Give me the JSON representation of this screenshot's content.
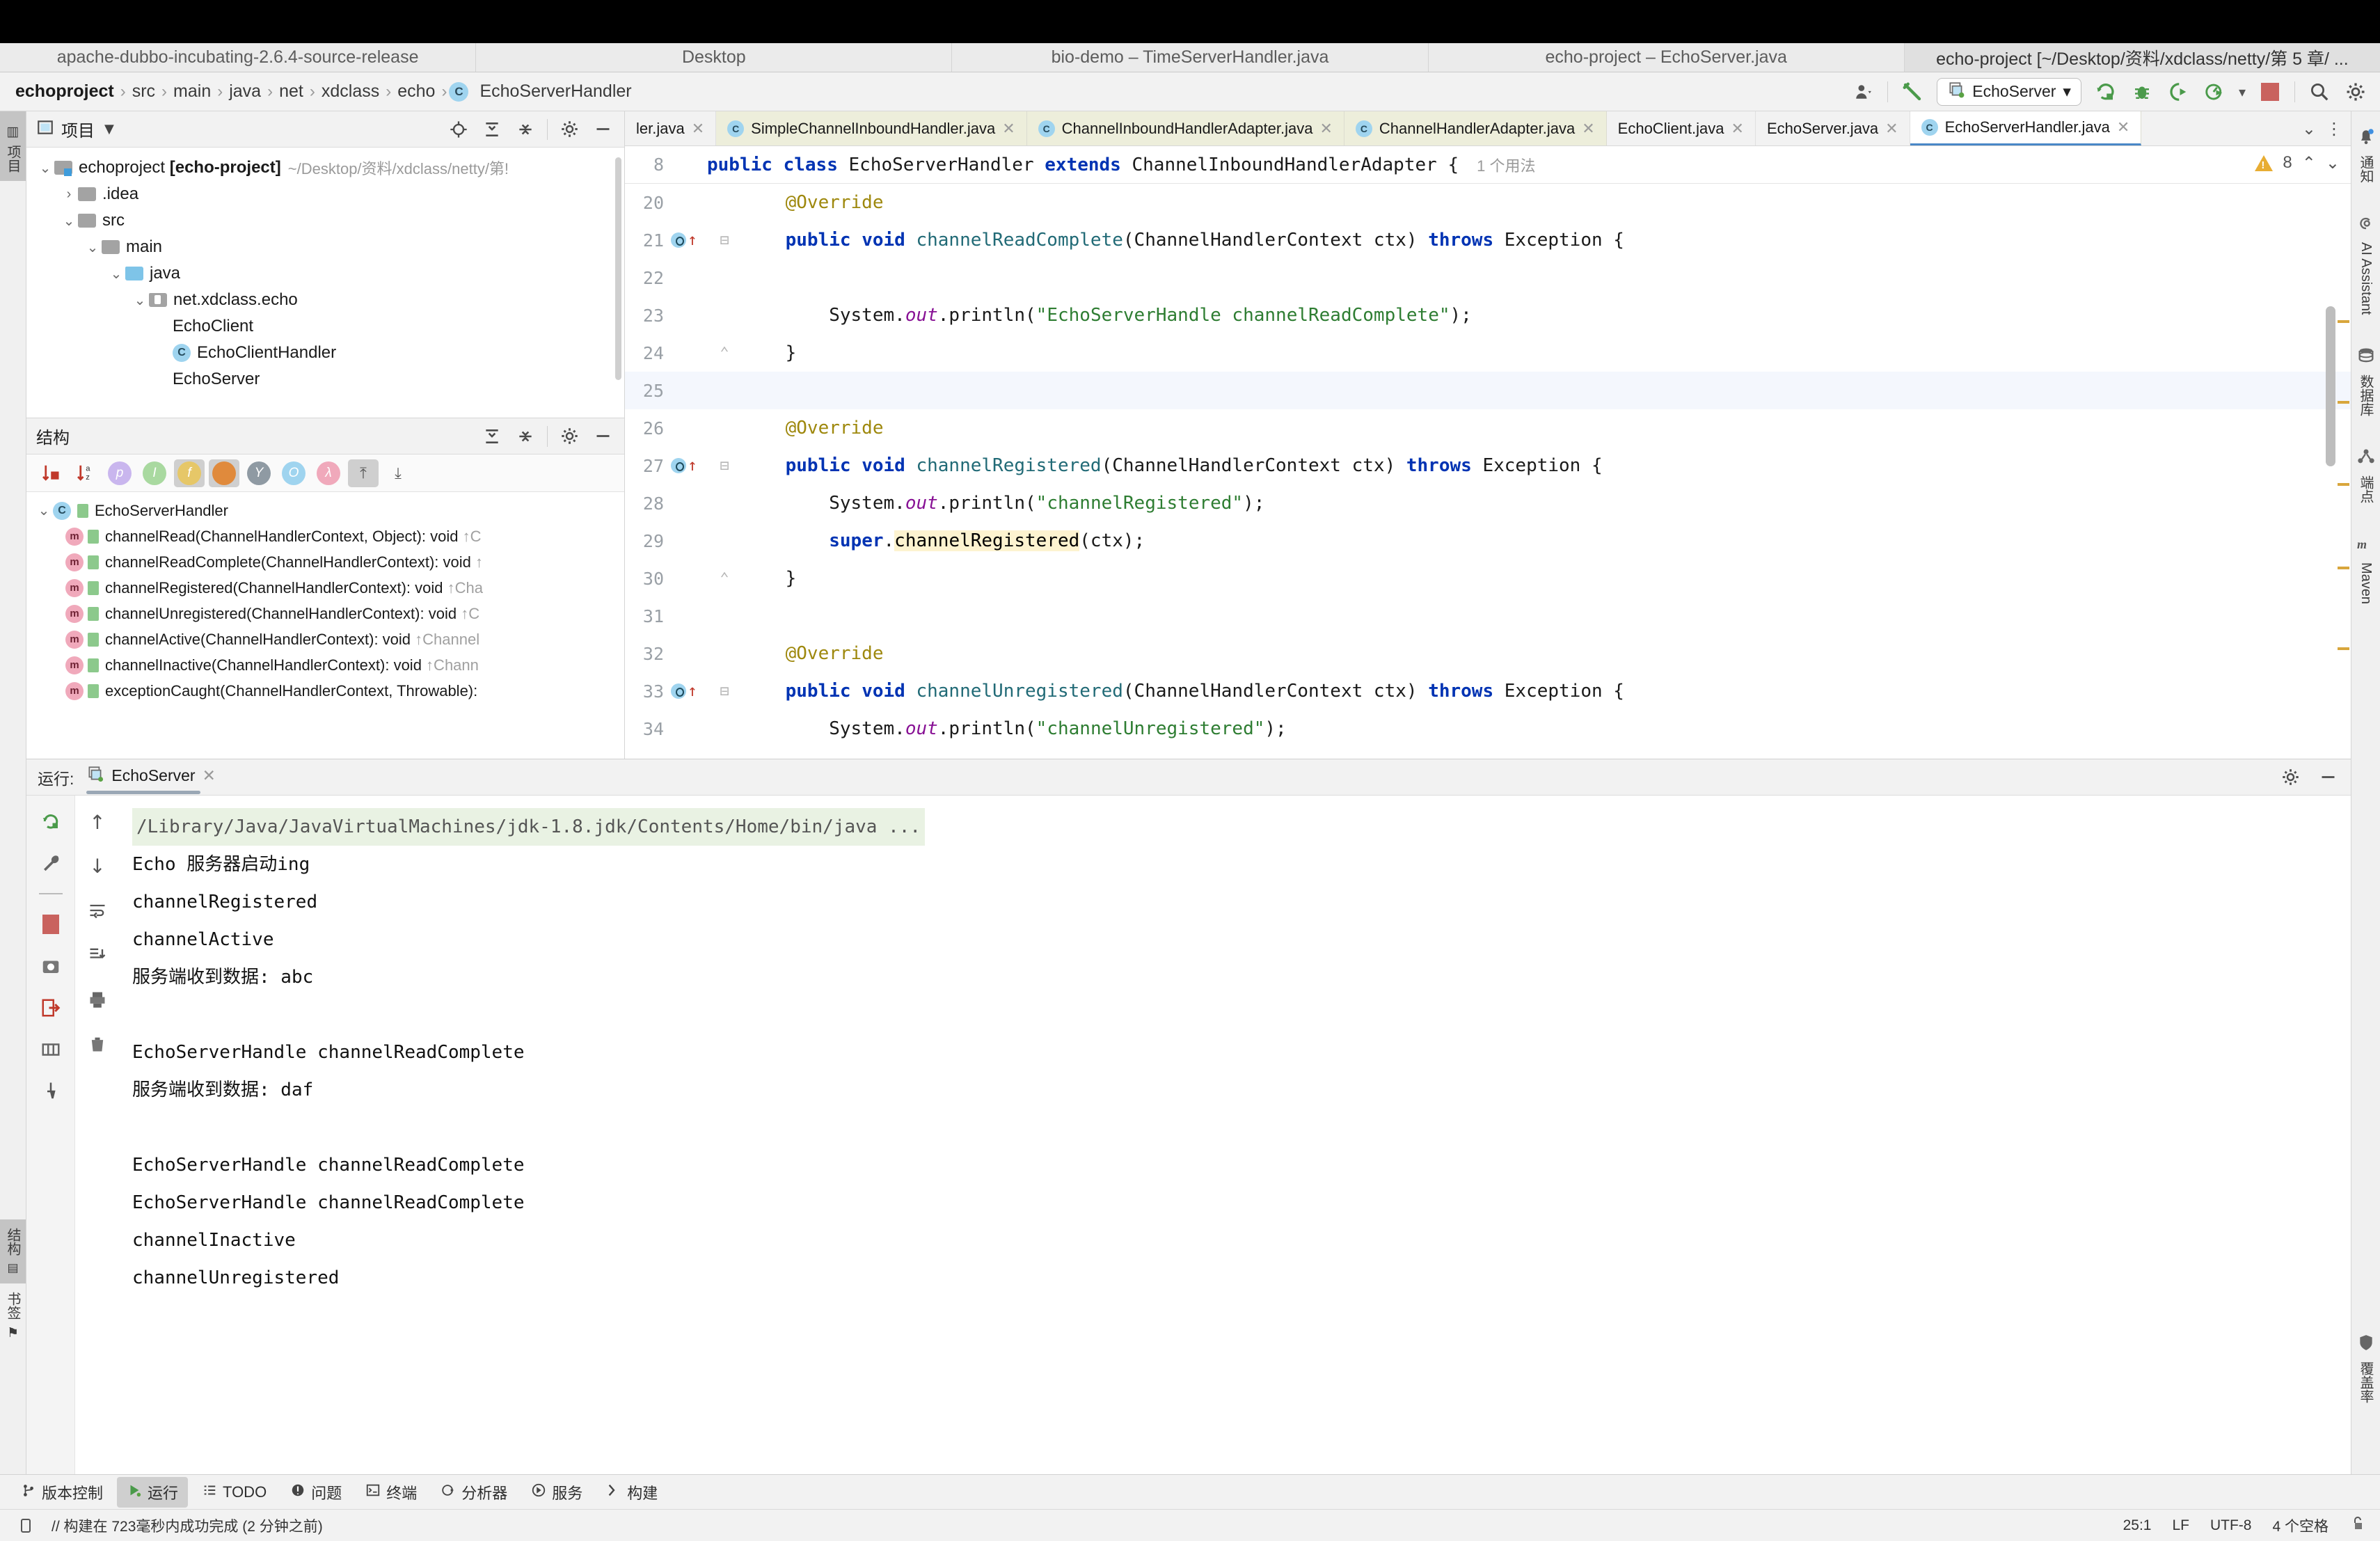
{
  "window_tabs": [
    {
      "label": "apache-dubbo-incubating-2.6.4-source-release",
      "active": false
    },
    {
      "label": "Desktop",
      "active": false
    },
    {
      "label": "bio-demo – TimeServerHandler.java",
      "active": false
    },
    {
      "label": "echo-project – EchoServer.java",
      "active": false
    },
    {
      "label": "echo-project [~/Desktop/资料/xdclass/netty/第 5 章/ ...",
      "active": true
    }
  ],
  "breadcrumb": {
    "items": [
      "echoproject",
      "src",
      "main",
      "java",
      "net",
      "xdclass",
      "echo"
    ],
    "file": "EchoServerHandler",
    "file_icon": "class-icon"
  },
  "toolbar": {
    "account_icon": "user-account-icon",
    "build_icon": "hammer-icon",
    "run_config": "EchoServer",
    "run_icon": "run-icon",
    "debug_icon": "debug-icon",
    "run_coverage_icon": "coverage-icon",
    "profiler_icon": "profiler-icon",
    "stop_icon": "stop-icon",
    "search_icon": "search-icon",
    "settings_icon": "gear-icon"
  },
  "left_rail": [
    {
      "label": "项目",
      "icon": "project-icon",
      "selected": true
    },
    {
      "label": "结构",
      "icon": "structure-icon",
      "selected": true
    },
    {
      "label": "书签",
      "icon": "bookmarks-icon",
      "selected": false
    }
  ],
  "right_rail": [
    {
      "label": "通知",
      "icon": "bell-icon"
    },
    {
      "label": "AI Assistant",
      "icon": "ai-assistant-icon"
    },
    {
      "label": "数据库",
      "icon": "database-icon"
    },
    {
      "label": "端点",
      "icon": "endpoints-icon"
    },
    {
      "label": "Maven",
      "icon": "maven-icon"
    },
    {
      "label": "覆盖率",
      "icon": "coverage-shield-icon"
    }
  ],
  "project_panel": {
    "title": "项目",
    "dropdown_icon": "chevron-down-icon",
    "actions": [
      "locate-icon",
      "expand-all-icon",
      "collapse-all-icon",
      "gear-icon",
      "minimize-icon"
    ],
    "tree": [
      {
        "indent": 0,
        "arrow": "v",
        "icon": "module-folder",
        "label": "echoproject",
        "bold_label": "[echo-project]",
        "path": "~/Desktop/资料/xdclass/netty/第!"
      },
      {
        "indent": 1,
        "arrow": ">",
        "icon": "folder",
        "label": ".idea",
        "bold_label": "",
        "path": ""
      },
      {
        "indent": 1,
        "arrow": "v",
        "icon": "folder",
        "label": "src",
        "bold_label": "",
        "path": ""
      },
      {
        "indent": 2,
        "arrow": "v",
        "icon": "folder",
        "label": "main",
        "bold_label": "",
        "path": ""
      },
      {
        "indent": 3,
        "arrow": "v",
        "icon": "folder-blue",
        "label": "java",
        "bold_label": "",
        "path": ""
      },
      {
        "indent": 4,
        "arrow": "v",
        "icon": "package",
        "label": "net.xdclass.echo",
        "bold_label": "",
        "path": ""
      },
      {
        "indent": 5,
        "arrow": "",
        "icon": "class-run",
        "label": "EchoClient",
        "bold_label": "",
        "path": ""
      },
      {
        "indent": 5,
        "arrow": "",
        "icon": "class",
        "label": "EchoClientHandler",
        "bold_label": "",
        "path": ""
      },
      {
        "indent": 5,
        "arrow": "",
        "icon": "class-run",
        "label": "EchoServer",
        "bold_label": "",
        "path": ""
      }
    ]
  },
  "structure_panel": {
    "title": "结构",
    "actions": [
      "expand-all-icon",
      "collapse-all-icon",
      "gear-icon",
      "minimize-icon"
    ],
    "filters": [
      {
        "name": "sort-by-visibility-icon",
        "glyph": "↓",
        "kind": "sort"
      },
      {
        "name": "sort-alphabetically-icon",
        "glyph": "↓",
        "kind": "sort"
      },
      {
        "name": "show-properties-icon",
        "glyph": "p",
        "color": "#c9b6ee"
      },
      {
        "name": "show-inherited-icon",
        "glyph": "I",
        "color": "#a9d9a0"
      },
      {
        "name": "show-fields-icon",
        "glyph": "f",
        "color": "#e6c768",
        "active": true
      },
      {
        "name": "show-non-public-icon",
        "glyph": "",
        "color": "#e08a3c",
        "active": true
      },
      {
        "name": "group-by-icon",
        "glyph": "Y",
        "color": "#8f9aa3"
      },
      {
        "name": "show-anonymous-icon",
        "glyph": "O",
        "color": "#9fd4ef"
      },
      {
        "name": "show-lambdas-icon",
        "glyph": "λ",
        "color": "#f0a9bb"
      },
      {
        "name": "expand-all-icon",
        "glyph": "⤒",
        "active": true
      },
      {
        "name": "collapse-all-icon",
        "glyph": "⤓"
      }
    ],
    "tree": [
      {
        "kind": "class",
        "label": "EchoServerHandler",
        "suffix": ""
      },
      {
        "kind": "method",
        "label": "channelRead(ChannelHandlerContext, Object): void",
        "suffix": "↑C"
      },
      {
        "kind": "method",
        "label": "channelReadComplete(ChannelHandlerContext): void",
        "suffix": "↑"
      },
      {
        "kind": "method",
        "label": "channelRegistered(ChannelHandlerContext): void",
        "suffix": "↑Cha"
      },
      {
        "kind": "method",
        "label": "channelUnregistered(ChannelHandlerContext): void",
        "suffix": "↑C"
      },
      {
        "kind": "method",
        "label": "channelActive(ChannelHandlerContext): void",
        "suffix": "↑Channel"
      },
      {
        "kind": "method",
        "label": "channelInactive(ChannelHandlerContext): void",
        "suffix": "↑Chann"
      },
      {
        "kind": "method",
        "label": "exceptionCaught(ChannelHandlerContext, Throwable):",
        "suffix": ""
      }
    ]
  },
  "editor_tabs": [
    {
      "label": "ler.java",
      "icon": "",
      "state": "clipped"
    },
    {
      "label": "SimpleChannelInboundHandler.java",
      "icon": "class-icon",
      "state": "library"
    },
    {
      "label": "ChannelInboundHandlerAdapter.java",
      "icon": "class-icon",
      "state": "library"
    },
    {
      "label": "ChannelHandlerAdapter.java",
      "icon": "class-icon",
      "state": "library"
    },
    {
      "label": "EchoClient.java",
      "icon": "class-run-icon",
      "state": "plain"
    },
    {
      "label": "EchoServer.java",
      "icon": "class-run-icon",
      "state": "plain"
    },
    {
      "label": "EchoServerHandler.java",
      "icon": "class-icon",
      "state": "active"
    }
  ],
  "editor": {
    "sticky_line_number": "8",
    "sticky_usage_hint": "1 个用法",
    "warning_count": "8",
    "warning_icon": "warning-triangle-icon",
    "prev_icon": "chevron-up-icon",
    "next_icon": "chevron-down-icon",
    "sticky_code": [
      {
        "t": "public ",
        "c": "kw"
      },
      {
        "t": "class ",
        "c": "kw"
      },
      {
        "t": "EchoServerHandler ",
        "c": "pl"
      },
      {
        "t": "extends ",
        "c": "kw"
      },
      {
        "t": "ChannelInboundHandlerAdapter {",
        "c": "pl"
      }
    ],
    "lines": [
      {
        "n": "20",
        "gutter": "",
        "fold": "",
        "cur": false,
        "parts": [
          {
            "t": "    @Override",
            "c": "ann"
          }
        ]
      },
      {
        "n": "21",
        "gutter": "override",
        "fold": "-",
        "cur": false,
        "parts": [
          {
            "t": "    ",
            "c": "pl"
          },
          {
            "t": "public void ",
            "c": "kw"
          },
          {
            "t": "channelReadComplete",
            "c": "mth"
          },
          {
            "t": "(ChannelHandlerContext ctx) ",
            "c": "pl"
          },
          {
            "t": "throws ",
            "c": "kw"
          },
          {
            "t": "Exception {",
            "c": "pl"
          }
        ]
      },
      {
        "n": "22",
        "gutter": "",
        "fold": "",
        "cur": false,
        "parts": []
      },
      {
        "n": "23",
        "gutter": "",
        "fold": "",
        "cur": false,
        "parts": [
          {
            "t": "        System.",
            "c": "pl"
          },
          {
            "t": "out",
            "c": "fld"
          },
          {
            "t": ".println(",
            "c": "pl"
          },
          {
            "t": "\"EchoServerHandle channelReadComplete\"",
            "c": "str"
          },
          {
            "t": ");",
            "c": "pl"
          }
        ]
      },
      {
        "n": "24",
        "gutter": "",
        "fold": "^",
        "cur": false,
        "parts": [
          {
            "t": "    }",
            "c": "pl"
          }
        ]
      },
      {
        "n": "25",
        "gutter": "",
        "fold": "",
        "cur": true,
        "parts": []
      },
      {
        "n": "26",
        "gutter": "",
        "fold": "",
        "cur": false,
        "parts": [
          {
            "t": "    @Override",
            "c": "ann"
          }
        ]
      },
      {
        "n": "27",
        "gutter": "override",
        "fold": "-",
        "cur": false,
        "parts": [
          {
            "t": "    ",
            "c": "pl"
          },
          {
            "t": "public void ",
            "c": "kw"
          },
          {
            "t": "channelRegistered",
            "c": "mth"
          },
          {
            "t": "(ChannelHandlerContext ctx) ",
            "c": "pl"
          },
          {
            "t": "throws ",
            "c": "kw"
          },
          {
            "t": "Exception {",
            "c": "pl"
          }
        ]
      },
      {
        "n": "28",
        "gutter": "",
        "fold": "",
        "cur": false,
        "parts": [
          {
            "t": "        System.",
            "c": "pl"
          },
          {
            "t": "out",
            "c": "fld"
          },
          {
            "t": ".println(",
            "c": "pl"
          },
          {
            "t": "\"channelRegistered\"",
            "c": "str"
          },
          {
            "t": ");",
            "c": "pl"
          }
        ]
      },
      {
        "n": "29",
        "gutter": "",
        "fold": "",
        "cur": false,
        "parts": [
          {
            "t": "        ",
            "c": "pl"
          },
          {
            "t": "super",
            "c": "kw"
          },
          {
            "t": ".",
            "c": "pl"
          },
          {
            "t": "channelRegistered",
            "c": "hl"
          },
          {
            "t": "(ctx);",
            "c": "pl"
          }
        ]
      },
      {
        "n": "30",
        "gutter": "",
        "fold": "^",
        "cur": false,
        "parts": [
          {
            "t": "    }",
            "c": "pl"
          }
        ]
      },
      {
        "n": "31",
        "gutter": "",
        "fold": "",
        "cur": false,
        "parts": []
      },
      {
        "n": "32",
        "gutter": "",
        "fold": "",
        "cur": false,
        "parts": [
          {
            "t": "    @Override",
            "c": "ann"
          }
        ]
      },
      {
        "n": "33",
        "gutter": "override",
        "fold": "-",
        "cur": false,
        "parts": [
          {
            "t": "    ",
            "c": "pl"
          },
          {
            "t": "public void ",
            "c": "kw"
          },
          {
            "t": "channelUnregistered",
            "c": "mth"
          },
          {
            "t": "(ChannelHandlerContext ctx) ",
            "c": "pl"
          },
          {
            "t": "throws ",
            "c": "kw"
          },
          {
            "t": "Exception {",
            "c": "pl"
          }
        ]
      },
      {
        "n": "34",
        "gutter": "",
        "fold": "",
        "cur": false,
        "parts": [
          {
            "t": "        System.",
            "c": "pl"
          },
          {
            "t": "out",
            "c": "fld"
          },
          {
            "t": ".println(",
            "c": "pl"
          },
          {
            "t": "\"channelUnregistered\"",
            "c": "str"
          },
          {
            "t": ");",
            "c": "pl"
          }
        ]
      }
    ]
  },
  "run_panel": {
    "label": "运行:",
    "tab": "EchoServer",
    "tab_icon": "run-config-icon",
    "close_icon": "close-icon",
    "settings_icon": "gear-icon",
    "minimize_icon": "minimize-icon",
    "rail_icons": [
      "rerun-icon",
      "wrench-icon",
      "stop-icon",
      "camera-icon",
      "export-icon",
      "layout-icon",
      "pin-icon"
    ],
    "rail2_icons": [
      "scroll-up-icon",
      "scroll-down-icon",
      "soft-wrap-icon",
      "scroll-to-end-icon",
      "print-icon",
      "clear-icon"
    ],
    "console": [
      {
        "text": "/Library/Java/JavaVirtualMachines/jdk-1.8.jdk/Contents/Home/bin/java ...",
        "cmd": true
      },
      {
        "text": "Echo 服务器启动ing",
        "cmd": false
      },
      {
        "text": "channelRegistered",
        "cmd": false
      },
      {
        "text": "channelActive",
        "cmd": false
      },
      {
        "text": "服务端收到数据: abc",
        "cmd": false
      },
      {
        "text": "",
        "cmd": false
      },
      {
        "text": "EchoServerHandle channelReadComplete",
        "cmd": false
      },
      {
        "text": "服务端收到数据: daf",
        "cmd": false
      },
      {
        "text": "",
        "cmd": false
      },
      {
        "text": "EchoServerHandle channelReadComplete",
        "cmd": false
      },
      {
        "text": "EchoServerHandle channelReadComplete",
        "cmd": false
      },
      {
        "text": "channelInactive",
        "cmd": false
      },
      {
        "text": "channelUnregistered",
        "cmd": false
      }
    ]
  },
  "bottom_bar": [
    {
      "label": "版本控制",
      "icon": "branch-icon",
      "selected": false
    },
    {
      "label": "运行",
      "icon": "run-icon",
      "selected": true
    },
    {
      "label": "TODO",
      "icon": "list-icon",
      "selected": false
    },
    {
      "label": "问题",
      "icon": "error-icon",
      "selected": false
    },
    {
      "label": "终端",
      "icon": "terminal-icon",
      "selected": false
    },
    {
      "label": "分析器",
      "icon": "profiler-icon",
      "selected": false
    },
    {
      "label": "服务",
      "icon": "services-icon",
      "selected": false
    },
    {
      "label": "构建",
      "icon": "build-icon",
      "selected": false
    }
  ],
  "status_bar": {
    "icon": "memory-icon",
    "message": "// 构建在 723毫秒内成功完成 (2 分钟之前)",
    "caret": "25:1",
    "line_sep": "LF",
    "encoding": "UTF-8",
    "indent": "4 个空格",
    "lock_icon": "unlock-icon"
  },
  "colors": {
    "accent": "#4a88c7",
    "keyword": "#0033b3",
    "string": "#2e7d32",
    "annotation": "#9e880d",
    "method": "#216a76",
    "field": "#871094",
    "highlight": "#fdf3d0",
    "warning": "#e8ad33"
  }
}
